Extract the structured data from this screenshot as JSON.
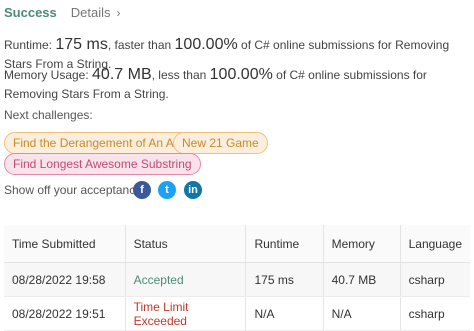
{
  "header": {
    "status": "Success",
    "details_label": "Details",
    "details_chevron": "›"
  },
  "runtime": {
    "prefix": "Runtime: ",
    "value": "175 ms",
    "middle": ", faster than ",
    "percent": "100.00%",
    "suffix": " of C# online submissions for Removing Stars From a String."
  },
  "memory": {
    "prefix": "Memory Usage: ",
    "value": "40.7 MB",
    "middle": ", less than ",
    "percent": "100.00%",
    "suffix": " of C# online submissions for Removing Stars From a String."
  },
  "challenges": {
    "label": "Next challenges:",
    "items": [
      {
        "label": "Find the Derangement of An Array",
        "difficulty": "medium"
      },
      {
        "label": "New 21 Game",
        "difficulty": "medium"
      },
      {
        "label": "Find Longest Awesome Substring",
        "difficulty": "hard"
      }
    ]
  },
  "share": {
    "label": "Show off your acceptance:",
    "icons": [
      "facebook-icon",
      "twitter-icon",
      "linkedin-icon"
    ],
    "glyphs": [
      "f",
      "t",
      "in"
    ]
  },
  "submissions": {
    "headers": [
      "Time Submitted",
      "Status",
      "Runtime",
      "Memory",
      "Language"
    ],
    "rows": [
      {
        "time": "08/28/2022 19:58",
        "status": "Accepted",
        "runtime": "175 ms",
        "memory": "40.7 MB",
        "language": "csharp"
      },
      {
        "time": "08/28/2022 19:51",
        "status": "Time Limit Exceeded",
        "runtime": "N/A",
        "memory": "N/A",
        "language": "csharp"
      }
    ]
  },
  "colors": {
    "success": "#4b8b74",
    "medium_tag": "#c98a2a",
    "hard_tag": "#c24a77",
    "tle": "#c0392b"
  }
}
